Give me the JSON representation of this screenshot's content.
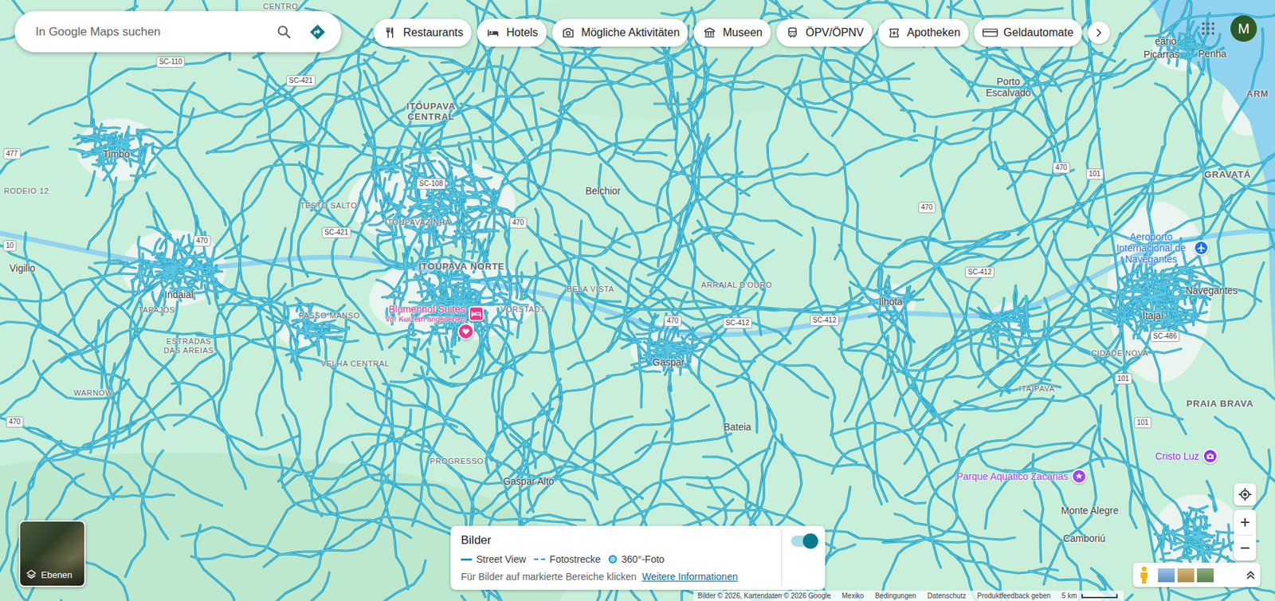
{
  "search": {
    "placeholder": "In Google Maps suchen"
  },
  "chips": [
    {
      "label": "Restaurants"
    },
    {
      "label": "Hotels"
    },
    {
      "label": "Mögliche Aktivitäten"
    },
    {
      "label": "Museen"
    },
    {
      "label": "ÖPV/ÖPNV"
    },
    {
      "label": "Apotheken"
    },
    {
      "label": "Geldautomate"
    }
  ],
  "account": {
    "initial": "M"
  },
  "map": {
    "labels": [
      {
        "text": "CENTRO",
        "kind": "district"
      },
      {
        "text": "SC-110",
        "kind": "road"
      },
      {
        "text": "SC-421",
        "kind": "road"
      },
      {
        "text": "ITOUPAVA CENTRAL",
        "kind": "suburb"
      },
      {
        "text": "Porto Escalvado",
        "kind": "place"
      },
      {
        "text": "eário",
        "kind": "place"
      },
      {
        "text": "Piçarras",
        "kind": "place"
      },
      {
        "text": "Penha",
        "kind": "place"
      },
      {
        "text": "ARM",
        "kind": "suburb"
      },
      {
        "text": "Timbó",
        "kind": "place"
      },
      {
        "text": "477",
        "kind": "road"
      },
      {
        "text": "RODEIO 12",
        "kind": "district"
      },
      {
        "text": "SC-108",
        "kind": "road"
      },
      {
        "text": "TESTO SALTO",
        "kind": "district"
      },
      {
        "text": "ITOUPAVAZINHA",
        "kind": "district"
      },
      {
        "text": "470",
        "kind": "road"
      },
      {
        "text": "SC-421",
        "kind": "road"
      },
      {
        "text": "470",
        "kind": "road"
      },
      {
        "text": "Belchior",
        "kind": "place"
      },
      {
        "text": "10",
        "kind": "road"
      },
      {
        "text": "Vigilio",
        "kind": "place"
      },
      {
        "text": "Indaial",
        "kind": "place"
      },
      {
        "text": "TAPAJÓS",
        "kind": "district"
      },
      {
        "text": "ITOUPAVA NORTE",
        "kind": "suburb"
      },
      {
        "text": "BELA VISTA",
        "kind": "district"
      },
      {
        "text": "VORSTADT",
        "kind": "district"
      },
      {
        "text": "ARRAIAL D'OURO",
        "kind": "district"
      },
      {
        "text": "Ilhota",
        "kind": "place"
      },
      {
        "text": "470",
        "kind": "road"
      },
      {
        "text": "470",
        "kind": "road"
      },
      {
        "text": "101",
        "kind": "road"
      },
      {
        "text": "GRAVATÁ",
        "kind": "suburb"
      },
      {
        "text": "SC-412",
        "kind": "road"
      },
      {
        "text": "Navegantes",
        "kind": "place"
      },
      {
        "text": "Itajaí",
        "kind": "place"
      },
      {
        "text": "SC-486",
        "kind": "road"
      },
      {
        "text": "CIDADE NOVA",
        "kind": "district"
      },
      {
        "text": "470",
        "kind": "road"
      },
      {
        "text": "SC-412",
        "kind": "road"
      },
      {
        "text": "SC-412",
        "kind": "road"
      },
      {
        "text": "Gaspar",
        "kind": "place"
      },
      {
        "text": "PASSO MANSO",
        "kind": "district"
      },
      {
        "text": "VELHA CENTRAL",
        "kind": "district"
      },
      {
        "text": "ESTRADAS DAS AREIAS",
        "kind": "district"
      },
      {
        "text": "WARNOW",
        "kind": "district"
      },
      {
        "text": "470",
        "kind": "road"
      },
      {
        "text": "101",
        "kind": "road"
      },
      {
        "text": "ITAIPAVA",
        "kind": "district"
      },
      {
        "text": "PRAIA BRAVA",
        "kind": "suburb"
      },
      {
        "text": "101",
        "kind": "road"
      },
      {
        "text": "Bateia",
        "kind": "place"
      },
      {
        "text": "PROGRESSO",
        "kind": "district"
      },
      {
        "text": "Gaspar Alto",
        "kind": "place"
      },
      {
        "text": "Monte Alegre",
        "kind": "place"
      },
      {
        "text": "Camboriú",
        "kind": "place"
      }
    ],
    "pois": [
      {
        "name": "Blumenhof Suites",
        "note": "Vor Kurzem angesehen",
        "kind": "hotel",
        "color": "#e8388a"
      },
      {
        "name": "Aeroporto Internacional de Navegantes",
        "kind": "airport",
        "color": "#1a73e8"
      },
      {
        "name": "Parque Aquático Zacarias",
        "kind": "park",
        "color": "#a142f4"
      },
      {
        "name": "Cristo Luz",
        "kind": "attraction",
        "color": "#9334e6"
      }
    ]
  },
  "layers": {
    "label": "Ebenen"
  },
  "legend": {
    "title": "Bilder",
    "toggle_on": true,
    "items": [
      {
        "label": "Street View",
        "kind": "line"
      },
      {
        "label": "Fotostrecke",
        "kind": "dashed"
      },
      {
        "label": "360°-Foto",
        "kind": "dot"
      }
    ],
    "hint": "Für Bilder auf markierte Bereiche klicken",
    "link": "Weitere Informationen"
  },
  "footer": [
    "Bilder © 2026, Kartendaten © 2026 Google",
    "Mexiko",
    "Bedingungen",
    "Datenschutz",
    "Produktfeedback geben",
    "5 km"
  ]
}
